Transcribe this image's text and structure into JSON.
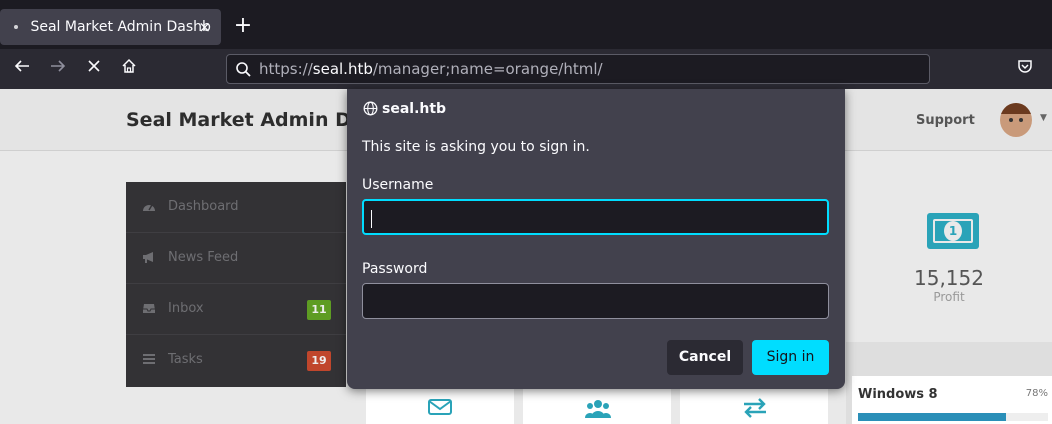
{
  "browser": {
    "tab_title": "Seal Market Admin Dashb",
    "tab_close": "×",
    "new_tab": "+",
    "url_scheme": "https://",
    "url_host": "seal.htb",
    "url_path": "/manager;name=orange/html/"
  },
  "page": {
    "site_title": "Seal Market Admin Da",
    "support_label": "Support",
    "sidebar": {
      "items": [
        {
          "label": "Dashboard",
          "icon": "dashboard-icon"
        },
        {
          "label": "News Feed",
          "icon": "megaphone-icon"
        },
        {
          "label": "Inbox",
          "icon": "inbox-icon",
          "badge": "11",
          "badge_color": "#5e9c23"
        },
        {
          "label": "Tasks",
          "icon": "tasks-icon",
          "badge": "19",
          "badge_color": "#c0462c"
        }
      ]
    },
    "profit": {
      "value": "15,152",
      "label": "Profit",
      "icon_glyph": "1"
    },
    "progress": {
      "label": "Windows 8",
      "percent_text": "78%",
      "percent": 78
    }
  },
  "dialog": {
    "host": "seal.htb",
    "message": "This site is asking you to sign in.",
    "username_label": "Username",
    "username_value": "",
    "password_label": "Password",
    "password_value": "",
    "cancel_label": "Cancel",
    "signin_label": "Sign in",
    "accent": "#00ddff"
  }
}
